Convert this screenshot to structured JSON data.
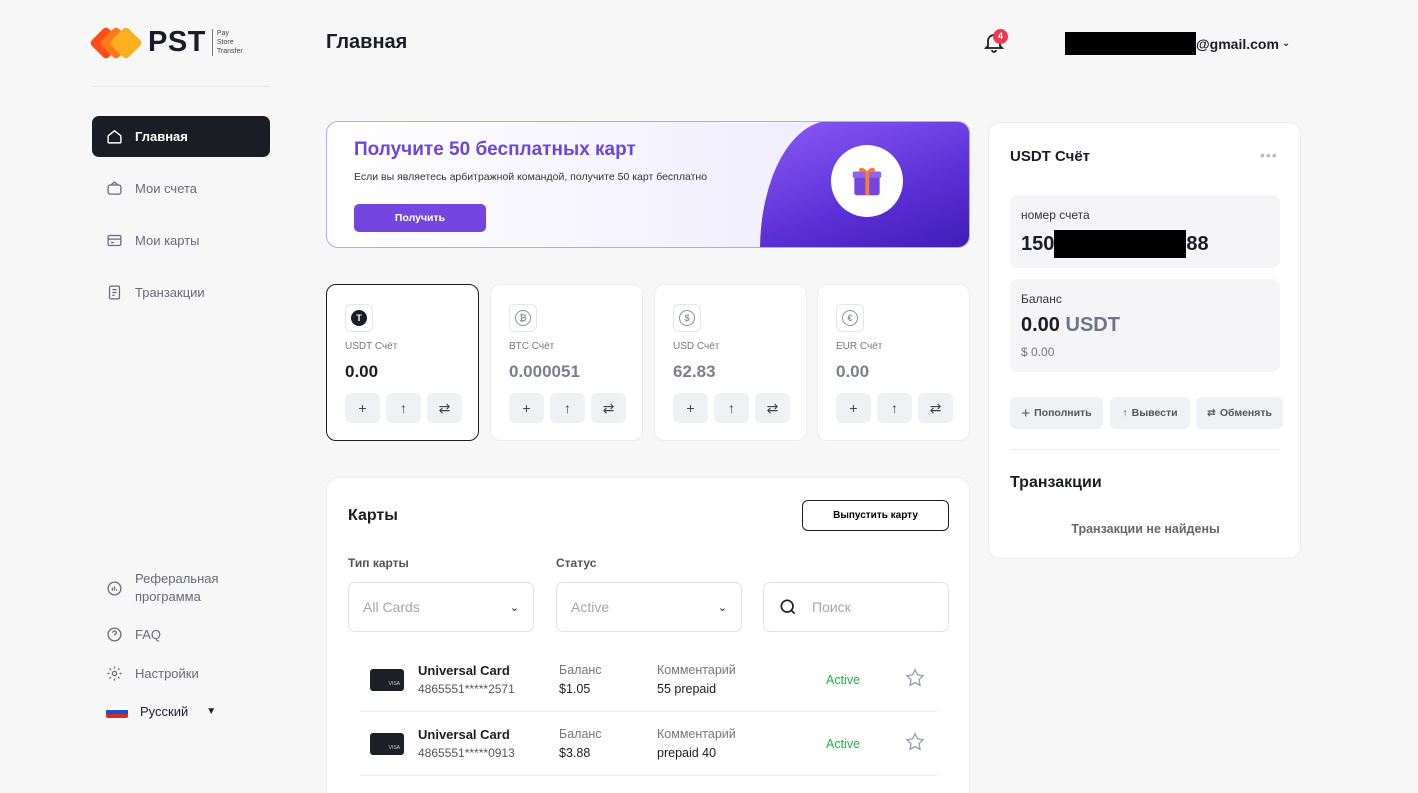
{
  "brand": {
    "name": "PST",
    "sub": [
      "Pay",
      "Store",
      "Transfer"
    ]
  },
  "sidebar": {
    "items": [
      {
        "label": "Главная",
        "icon": "home-icon"
      },
      {
        "label": "Мои счета",
        "icon": "wallet-icon"
      },
      {
        "label": "Мои карты",
        "icon": "card-icon"
      },
      {
        "label": "Транзакции",
        "icon": "receipt-icon"
      }
    ],
    "bottom": [
      {
        "label": "Реферальная программа",
        "label1": "Реферальная",
        "label2": "программа",
        "icon": "referral-icon"
      },
      {
        "label": "FAQ",
        "icon": "help-icon"
      },
      {
        "label": "Настройки",
        "icon": "gear-icon"
      }
    ],
    "language": "Русский"
  },
  "header": {
    "title": "Главная",
    "notifications": "4",
    "email_suffix": "@gmail.com"
  },
  "promo": {
    "title": "Получите 50 бесплатных карт",
    "text": "Если вы являетесь арбитражной командой, получите 50 карт бесплатно",
    "button": "Получить"
  },
  "accounts": [
    {
      "label": "USDT Счёт",
      "value": "0.00",
      "symbol": "T",
      "color": "#1c1c28"
    },
    {
      "label": "BTC Счёт",
      "value": "0.000051",
      "symbol": "₿",
      "color": "#8a8f9c"
    },
    {
      "label": "USD Счёт",
      "value": "62.83",
      "symbol": "$",
      "color": "#8a8f9c"
    },
    {
      "label": "EUR Счёт",
      "value": "0.00",
      "symbol": "€",
      "color": "#8a8f9c"
    }
  ],
  "cards_panel": {
    "title": "Карты",
    "issue_button": "Выпустить карту",
    "type_label": "Тип карты",
    "type_value": "All Cards",
    "status_label": "Статус",
    "status_value": "Active",
    "search_placeholder": "Поиск",
    "balance_label": "Баланс",
    "comment_label": "Комментарий",
    "rows": [
      {
        "name": "Universal Card",
        "number": "4865551*****2571",
        "balance": "$1.05",
        "comment": "55 prepaid",
        "status": "Active"
      },
      {
        "name": "Universal Card",
        "number": "4865551*****0913",
        "balance": "$3.88",
        "comment": "prepaid 40",
        "status": "Active"
      }
    ]
  },
  "account_panel": {
    "title": "USDT Счёт",
    "number_label": "номер счета",
    "number_prefix": "150",
    "number_suffix": "88",
    "balance_label": "Баланс",
    "balance_value": "0.00",
    "balance_currency": "USDT",
    "balance_usd": "$ 0.00",
    "actions": [
      "Пополнить",
      "Вывести",
      "Обменять"
    ],
    "tx_title": "Транзакции",
    "tx_empty": "Транзакции не найдены"
  },
  "colors": {
    "accent": "#7446e0",
    "active_nav": "#1a1d23",
    "status_active": "#2ba84a",
    "badge": "#f2384f"
  }
}
